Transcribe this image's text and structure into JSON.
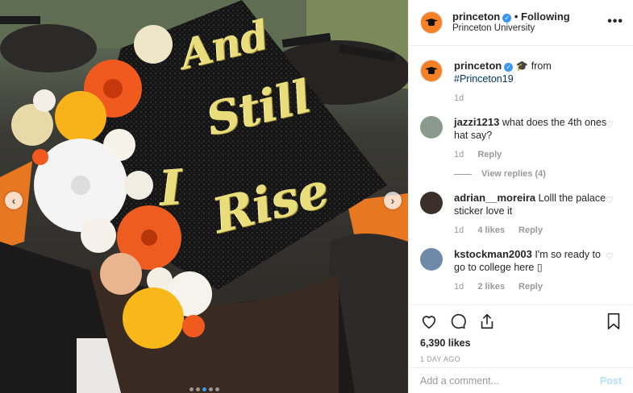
{
  "photo": {
    "cap_lines": [
      "And",
      "Still",
      "I",
      "Rise"
    ]
  },
  "header": {
    "username": "princeton",
    "separator": "•",
    "following_label": "Following",
    "subtitle": "Princeton University",
    "more_label": "•••"
  },
  "caption": {
    "username": "princeton",
    "text_prefix": "from",
    "hashtag": "#Princeton19",
    "time": "1d"
  },
  "comments": [
    {
      "username": "jazzi1213",
      "text": "what does the 4th ones hat say?",
      "time": "1d",
      "likes": "",
      "reply_label": "Reply",
      "view_replies": "View replies (4)",
      "avatar_color": "#8a9a8e"
    },
    {
      "username": "adrian__moreira",
      "text": "Lolll the palace sticker love it",
      "time": "1d",
      "likes": "4 likes",
      "reply_label": "Reply",
      "avatar_color": "#3b2f2a"
    },
    {
      "username": "kstockman2003",
      "text": "I'm so ready to go to college here ▯",
      "time": "1d",
      "likes": "2 likes",
      "reply_label": "Reply",
      "avatar_color": "#6f8aa8"
    }
  ],
  "actions": {
    "likes": "6,390 likes",
    "date": "1 DAY AGO"
  },
  "add_comment": {
    "placeholder": "Add a comment...",
    "post_label": "Post"
  },
  "colors": {
    "brand_orange": "#f58025",
    "verified_blue": "#3897f0",
    "link_blue": "#003569",
    "muted": "#999999"
  },
  "icons": [
    "heart-icon",
    "comment-icon",
    "share-icon",
    "bookmark-icon",
    "verified-icon",
    "grad-cap-emoji"
  ]
}
